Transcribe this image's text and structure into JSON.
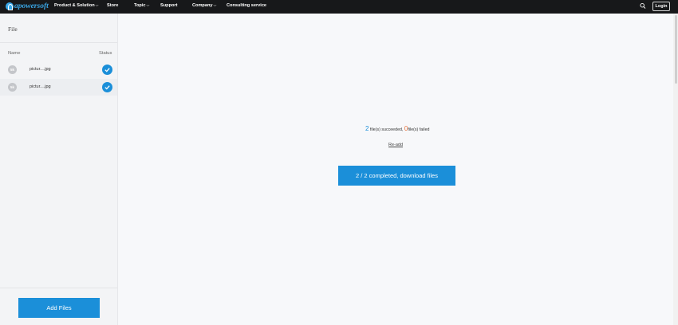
{
  "header": {
    "logo_text": "apowersoft",
    "nav": [
      {
        "label": "Product & Solution",
        "has_caret": true
      },
      {
        "label": "Store",
        "has_caret": false
      },
      {
        "label": "Topic",
        "has_caret": true
      },
      {
        "label": "Support",
        "has_caret": false
      },
      {
        "label": "Company",
        "has_caret": true
      },
      {
        "label": "Consulting service",
        "has_caret": false
      }
    ],
    "login_label": "Login",
    "search_icon": "search-icon"
  },
  "sidebar": {
    "title": "File",
    "col_name": "Name",
    "col_status": "Status",
    "files": [
      {
        "thumb": "5k",
        "name": "pictur....jpg",
        "status": "completed"
      },
      {
        "thumb": "5k",
        "name": "pictur....jpg",
        "status": "completed"
      }
    ],
    "add_files_label": "Add Files"
  },
  "main": {
    "succeeded_count": "2",
    "succeeded_label": " file(s) succeeded, ",
    "failed_count": "0",
    "failed_label": "file(s) failed",
    "readd_label": "Re-add",
    "download_label": "2 / 2 completed, download files"
  },
  "colors": {
    "accent": "#1b8fd9",
    "failed": "#e8703a",
    "topbar": "#17181a"
  }
}
